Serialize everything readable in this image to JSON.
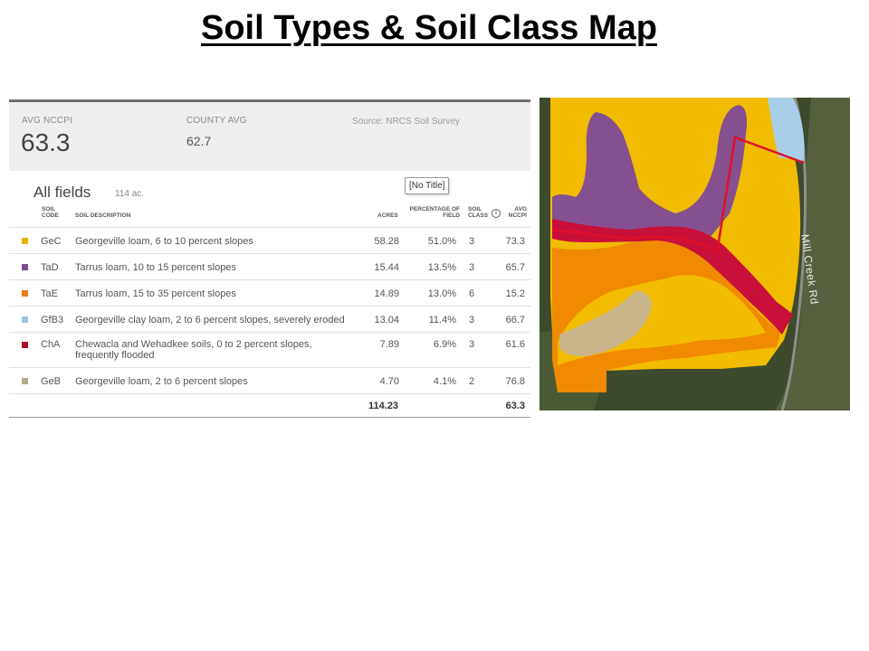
{
  "slide": {
    "title": "Soil Types & Soil Class Map"
  },
  "summary": {
    "avg_label": "AVG NCCPI",
    "avg_value": "63.3",
    "county_label": "COUNTY AVG",
    "county_value": "62.7",
    "source": "Source: NRCS Soil Survey"
  },
  "fields": {
    "title": "All fields",
    "acres": "114 ac.",
    "tooltip": "[No Title]"
  },
  "table": {
    "headers": {
      "code": "SOIL CODE",
      "description": "SOIL DESCRIPTION",
      "acres": "ACRES",
      "pct": "PERCENTAGE OF FIELD",
      "class": "SOIL CLASS",
      "nccpi": "AVG NCCPI"
    },
    "info_icon": "i",
    "rows": [
      {
        "color": "#e8b400",
        "code": "GeC",
        "description": "Georgeville loam, 6 to 10 percent slopes",
        "acres": "58.28",
        "pct": "51.0%",
        "class": "3",
        "nccpi": "73.3"
      },
      {
        "color": "#7d4a8c",
        "code": "TaD",
        "description": "Tarrus loam, 10 to 15 percent slopes",
        "acres": "15.44",
        "pct": "13.5%",
        "class": "3",
        "nccpi": "65.7"
      },
      {
        "color": "#e8801a",
        "code": "TaE",
        "description": "Tarrus loam, 15 to 35 percent slopes",
        "acres": "14.89",
        "pct": "13.0%",
        "class": "6",
        "nccpi": "15.2"
      },
      {
        "color": "#9cc4e4",
        "code": "GfB3",
        "description": "Georgeville clay loam, 2 to 6 percent slopes, severely eroded",
        "acres": "13.04",
        "pct": "11.4%",
        "class": "3",
        "nccpi": "66.7"
      },
      {
        "color": "#a8102e",
        "code": "ChA",
        "description": "Chewacla and Wehadkee soils, 0 to 2 percent slopes, frequently flooded",
        "acres": "7.89",
        "pct": "6.9%",
        "class": "3",
        "nccpi": "61.6"
      },
      {
        "color": "#b5a98a",
        "code": "GeB",
        "description": "Georgeville loam, 2 to 6 percent slopes",
        "acres": "4.70",
        "pct": "4.1%",
        "class": "2",
        "nccpi": "76.8"
      }
    ],
    "total": {
      "acres": "114.23",
      "nccpi": "63.3"
    }
  },
  "map": {
    "road_label": "Mill Creek Rd",
    "colors": {
      "GeC": "#f2bc00",
      "TaD": "#84508f",
      "TaE": "#f08a00",
      "GfB3": "#a8cfe8",
      "ChA": "#c8103a",
      "GeB": "#c9b48a",
      "boundary": "#e0102a",
      "imagery": "#3d4a2e"
    }
  }
}
